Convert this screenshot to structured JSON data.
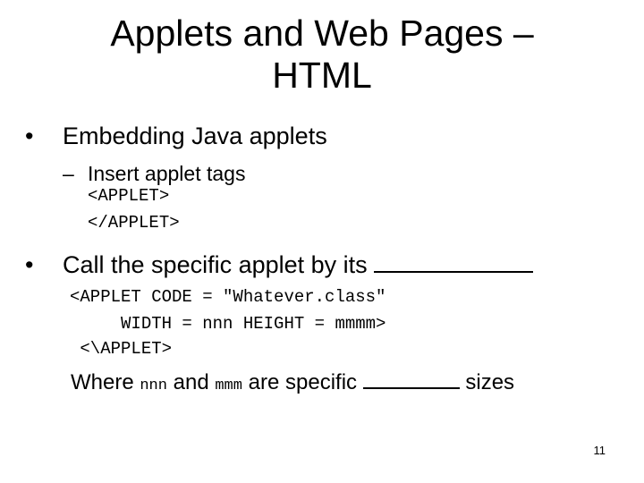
{
  "slide": {
    "title_line1": "Applets and Web Pages –",
    "title_line2": "HTML",
    "bullets": [
      {
        "marker": "•",
        "text": "Embedding Java applets",
        "sub": {
          "marker": "–",
          "text": "Insert applet tags"
        },
        "code": [
          "<APPLET>",
          "</APPLET>"
        ]
      },
      {
        "marker": "•",
        "text": "Call the specific applet by its",
        "code": [
          "<APPLET CODE = \"Whatever.class\"",
          "     WIDTH = nnn HEIGHT = mmmm>",
          " <\\APPLET>"
        ]
      }
    ],
    "where_line": {
      "part1": "Where ",
      "var1": "nnn",
      "part2": " and ",
      "var2": "mmm",
      "part3": " are specific ",
      "part4": " sizes"
    },
    "page_number": "11"
  }
}
